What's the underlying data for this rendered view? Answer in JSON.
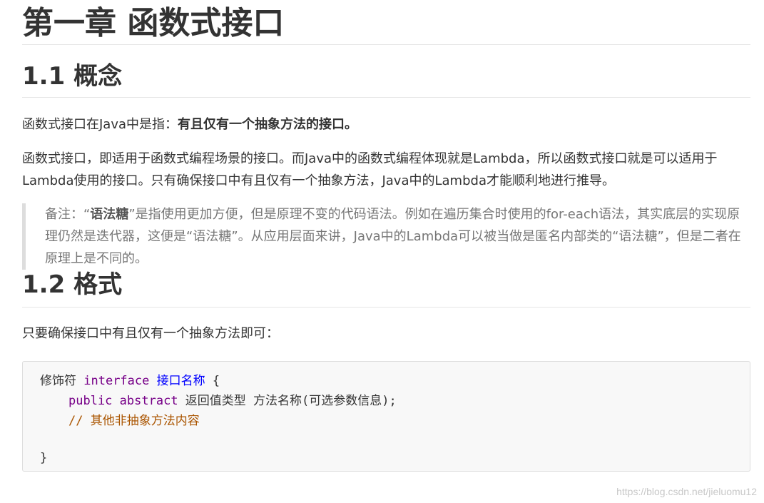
{
  "chapter_title": "第一章 函数式接口",
  "section1": {
    "title": "1.1 概念",
    "p1_text": "函数式接口在Java中是指：",
    "p1_bold": "有且仅有一个抽象方法的接口。",
    "p2": "函数式接口，即适用于函数式编程场景的接口。而Java中的函数式编程体现就是Lambda，所以函数式接口就是可以适用于Lambda使用的接口。只有确保接口中有且仅有一个抽象方法，Java中的Lambda才能顺利地进行推导。",
    "note_prefix": "备注：“",
    "note_bold": "语法糖",
    "note_rest": "”是指使用更加方便，但是原理不变的代码语法。例如在遍历集合时使用的for-each语法，其实底层的实现原理仍然是迭代器，这便是“语法糖”。从应用层面来讲，Java中的Lambda可以被当做是匿名内部类的“语法糖”，但是二者在原理上是不同的。"
  },
  "section2": {
    "title": "1.2 格式",
    "p4": "只要确保接口中有且仅有一个抽象方法即可："
  },
  "code": {
    "l1_mod": "修饰符 ",
    "l1_kw": "interface",
    "l1_sp": " ",
    "l1_name": "接口名称",
    "l1_brace": " {",
    "l2_kw1": "public",
    "l2_sp": " ",
    "l2_kw2": "abstract",
    "l2_rest": " 返回值类型 方法名称(可选参数信息);",
    "l3_comment": "// 其他非抽象方法内容",
    "l5_brace": "}"
  },
  "watermark": "https://blog.csdn.net/jieluomu12"
}
